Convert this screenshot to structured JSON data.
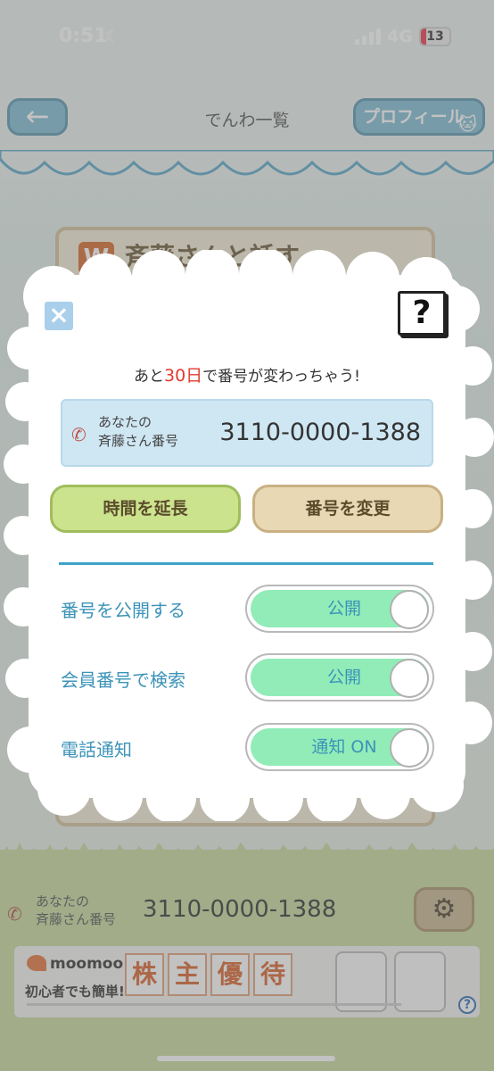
{
  "status_bar": {
    "time": "0:51",
    "network": "4G",
    "battery": "13"
  },
  "nav": {
    "back_glyph": "←",
    "title": "でんわ一覧",
    "profile_label": "プロフィール"
  },
  "background_card": {
    "badge": "W",
    "heading": "斉藤さんと話す"
  },
  "modal": {
    "close_glyph": "×",
    "help_glyph": "?",
    "notice_prefix": "あと",
    "notice_days": "30日",
    "notice_suffix": "で番号が変わっちゃう!",
    "number_label_line1": "あなたの",
    "number_label_line2": "斉藤さん番号",
    "number_value": "3110-0000-1388",
    "extend_button": "時間を延長",
    "change_button": "番号を変更",
    "settings": [
      {
        "label": "番号を公開する",
        "toggle_text": "公開",
        "on": true
      },
      {
        "label": "会員番号で検索",
        "toggle_text": "公開",
        "on": true
      },
      {
        "label": "電話通知",
        "toggle_text": "通知 ON",
        "on": true
      }
    ]
  },
  "bottom_bar": {
    "label_line1": "あなたの",
    "label_line2": "斉藤さん番号",
    "number": "3110-0000-1388"
  },
  "ad": {
    "brand": "moomoo",
    "subtitle": "初心者でも簡単!",
    "chars": [
      "株",
      "主",
      "優",
      "待"
    ],
    "help": "?"
  },
  "colors": {
    "accent_blue": "#3c93b8",
    "alert_red": "#e03b2c",
    "toggle_green": "#91ecb8",
    "extend_green": "#cce38e",
    "change_tan": "#e8d8b3"
  },
  "icons": [
    "moon-icon",
    "signal-icon",
    "battery-icon",
    "back-arrow-icon",
    "cat-icon",
    "close-icon",
    "help-icon",
    "phone-icon",
    "gear-icon"
  ]
}
